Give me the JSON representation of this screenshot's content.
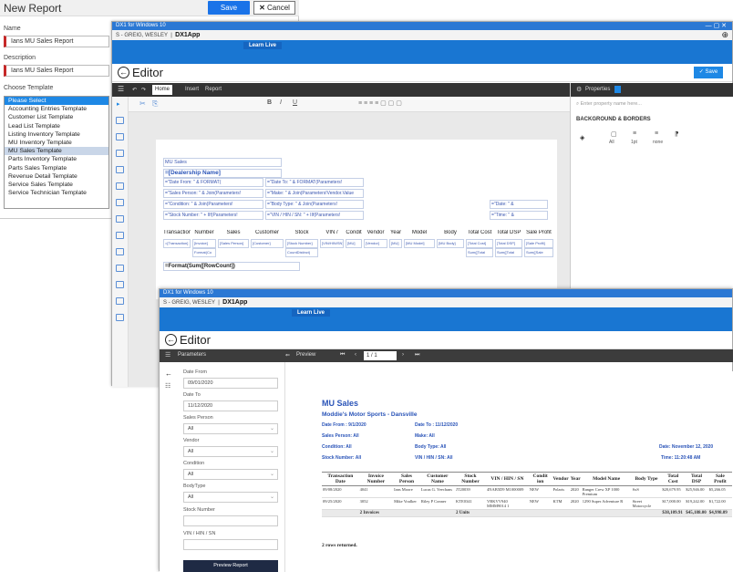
{
  "new_report": {
    "title": "New Report",
    "save": "Save",
    "cancel": "Cancel",
    "name_label": "Name",
    "name_value": "Ians MU Sales Report",
    "desc_label": "Description",
    "desc_value": "Ians MU Sales Report",
    "template_label": "Choose Template",
    "templates": [
      "Please Select",
      "Accounting Entries Template",
      "Customer List Template",
      "Lead List Template",
      "Listing Inventory Template",
      "MU Inventory Template",
      "MU Sales Template",
      "Parts Inventory Template",
      "Parts Sales Template",
      "Revenue Detail Template",
      "Service Sales Template",
      "Service Technician Template"
    ]
  },
  "editor": {
    "window_title": "DX1 for Windows 10",
    "user": "S - GREIG, WESLEY",
    "app": "DX1App",
    "learn_live": "Learn Live",
    "title": "Editor",
    "save": "Save",
    "tabs": [
      "Home",
      "Insert",
      "Report"
    ],
    "props_tab": "Properties",
    "props_search": "Enter property name here...",
    "props_section": "BACKGROUND & BORDERS",
    "props_values": [
      "All",
      "1pt",
      "none"
    ],
    "design": {
      "mu_sales": "MU Sales",
      "dealership": "=[Dealership Name]",
      "line1a": "=\"Date From: \" & FORMAT(",
      "line1b": "=\"Date To: \" & FORMAT(Parameters!",
      "line2a": "=\"Sales Person: \" & Join(Parameters!",
      "line2b": "=\"Make: \" & Join(Parameters!Vendor.Value",
      "line3a": "=\"Condition: \" & Join(Parameters!",
      "line3b": "=\"Body Type: \" & Join(Parameters!",
      "line3c": "=\"Date: \" &",
      "line4a": "=\"Stock Number: \" + IIf(Parameters!",
      "line4b": "=\"VIN / HIN / SN: \" + IIf(Parameters!",
      "line4c": "=\"Time: \" &",
      "headers": [
        "Transaction",
        "Number",
        "Sales",
        "Customer",
        "Stock",
        "VIN /",
        "Condit",
        "Vendor",
        "Year",
        "Model",
        "Body",
        "Total Cost",
        "Total DSP",
        "Sale Profit"
      ],
      "row": [
        "=[Transaction]",
        "[Invoice]",
        "[Sales Person]",
        "[Customer]",
        "[Stock Number]",
        "[VIN/HIN/SN]",
        "[MU]",
        "[Vendor]",
        "[MU]",
        "[MU Model]",
        "[MU Body]",
        "[Total Cost]",
        "[Total DSP]",
        "[Sale Profit]"
      ],
      "row2": [
        "Format(Co",
        "CountDistinct(",
        "Sum([Total",
        "Sum([Total",
        "Sum([Sale"
      ],
      "rowcount": "=Format(Sum([RowCount])"
    }
  },
  "preview": {
    "window_title": "DX1 for Windows 10",
    "user": "S - GREIG, WESLEY",
    "app": "DX1App",
    "learn_live": "Learn Live",
    "title": "Editor",
    "parameters": "Parameters",
    "preview_label": "Preview",
    "page": "1 / 1",
    "params": [
      {
        "label": "Date From",
        "value": "09/01/2020"
      },
      {
        "label": "Date To",
        "value": "11/12/2020"
      },
      {
        "label": "Sales Person",
        "value": "All"
      },
      {
        "label": "Vendor",
        "value": "All"
      },
      {
        "label": "Condition",
        "value": "All"
      },
      {
        "label": "BodyType",
        "value": "All"
      },
      {
        "label": "Stock Number",
        "value": ""
      },
      {
        "label": "VIN / HIN / SN",
        "value": ""
      }
    ],
    "preview_button": "Preview Report",
    "report": {
      "title": "MU Sales",
      "dealer": "Moddie's Motor Sports - Dansville",
      "date_from": "Date From : 9/1/2020",
      "date_to": "Date To : 11/12/2020",
      "sales_person": "Sales Person: All",
      "make": "Make: All",
      "condition": "Condition: All",
      "body_type": "Body Type: All",
      "date": "Date: November 12, 2020",
      "stock": "Stock Number: All",
      "vin": "VIN / HIN / SN: All",
      "time": "Time: 11:20:48 AM",
      "columns": [
        "Transaction Date",
        "Invoice Number",
        "Sales Person",
        "Customer Name",
        "Stock Number",
        "VIN / HIN / SN",
        "Condit ion",
        "Vendor",
        "Year",
        "Model Name",
        "Body Type",
        "Total Cost",
        "Total DSP",
        "Sale Profit"
      ],
      "rows": [
        [
          "09/08/2020",
          "4041",
          "Ians Moore",
          "Lucas G. Yeechans",
          "JT20039",
          "4NAB5D9 M1000009",
          "NEW",
          "Polaris",
          "2020",
          "Ranger Crew XP 1000 Premium",
          "SxS",
          "$20,679.95",
          "$25,946.00",
          "$5,266.05"
        ],
        [
          "09/25/2020",
          "3052",
          "Mike Voulker",
          "Riley P Conner",
          "KTE0341",
          "VBKVV940 MMM9014 1",
          "NEW",
          "KTM",
          "2020",
          "1290 Super Adventure R",
          "Street Motorcycle",
          "$17,000.00",
          "$19,242.00",
          "$1,722.00"
        ]
      ],
      "totals": [
        "2 Invoices",
        "2 Units",
        "$38,109.91",
        "$45,188.00",
        "$4,998.09"
      ],
      "footer": "2 rows returned."
    }
  }
}
